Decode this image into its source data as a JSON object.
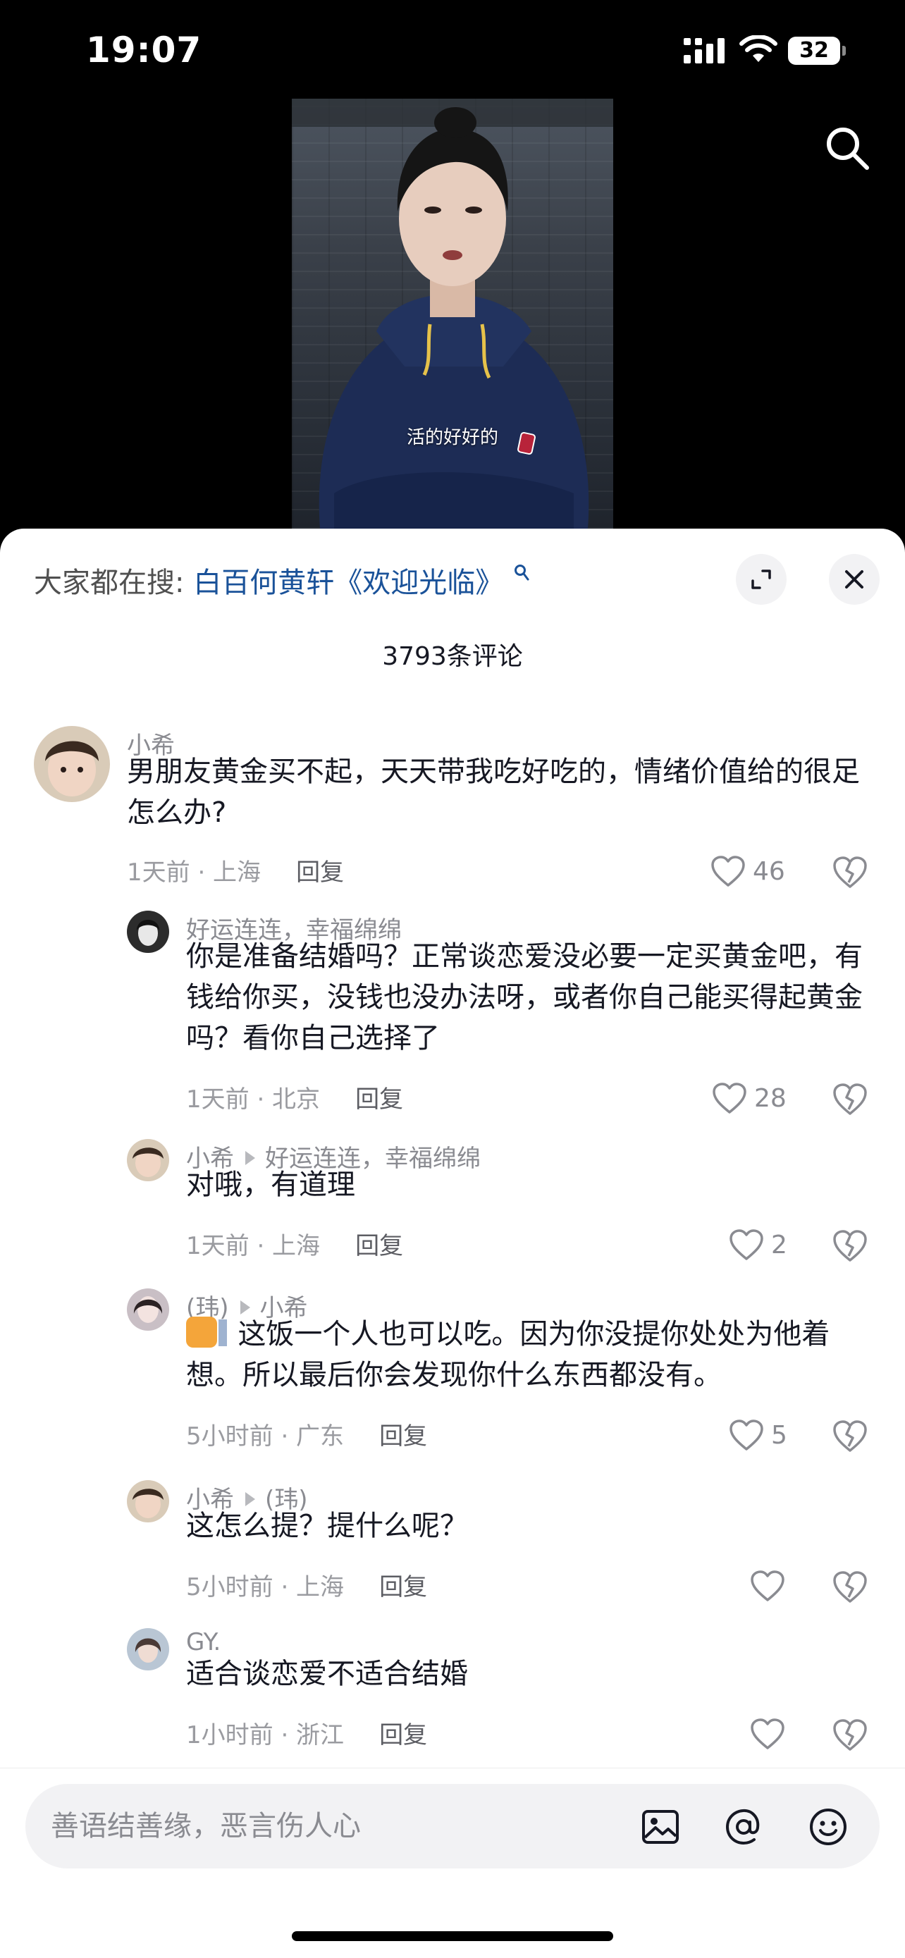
{
  "status_bar": {
    "time": "19:07",
    "battery": "32"
  },
  "video": {
    "caption": "活的好好的"
  },
  "hot_search": {
    "prefix": "大家都在搜:",
    "term": "白百何黄轩《欢迎光临》"
  },
  "comment_count": "3793条评论",
  "comments": [
    {
      "name": "小希",
      "reply_to": "",
      "text": "男朋友黄金买不起，天天带我吃好吃的，情绪价值给的很足怎么办?",
      "meta": "1天前 · 上海",
      "reply": "回复",
      "likes": "46"
    },
    {
      "name": "好运连连，幸福绵绵",
      "reply_to": "",
      "text": "你是准备结婚吗？正常谈恋爱没必要一定买黄金吧，有钱给你买，没钱也没办法呀，或者你自己能买得起黄金吗？看你自己选择了",
      "meta": "1天前 · 北京",
      "reply": "回复",
      "likes": "28"
    },
    {
      "name": "小希",
      "reply_to": "好运连连，幸福绵绵",
      "text": "对哦，有道理",
      "meta": "1天前 · 上海",
      "reply": "回复",
      "likes": "2"
    },
    {
      "name": "(玮)",
      "reply_to": "小希",
      "text": "这饭一个人也可以吃。因为你没提你处处为他着想。所以最后你会发现你什么东西都没有。",
      "meta": "5小时前 · 广东",
      "reply": "回复",
      "likes": "5"
    },
    {
      "name": "小希",
      "reply_to": "(玮)",
      "text": "这怎么提？提什么呢？",
      "meta": "5小时前 · 上海",
      "reply": "回复",
      "likes": ""
    },
    {
      "name": "GY.",
      "reply_to": "",
      "text": "适合谈恋爱不适合结婚",
      "meta": "1小时前 · 浙江",
      "reply": "回复",
      "likes": ""
    }
  ],
  "input": {
    "placeholder": "善语结善缘，恶言伤人心"
  },
  "icons": {
    "search": "search-icon",
    "expand": "expand-icon",
    "close": "close-icon",
    "like": "heart-outline-icon",
    "dislike": "broken-heart-icon",
    "image": "image-icon",
    "mention": "at-icon",
    "emoji": "smiley-icon"
  },
  "colors": {
    "link_blue": "#1a5299",
    "text_dark": "#161823",
    "text_gray": "#8a8b91",
    "sheet_bg": "#ffffff",
    "field_bg": "#f2f2f4"
  }
}
